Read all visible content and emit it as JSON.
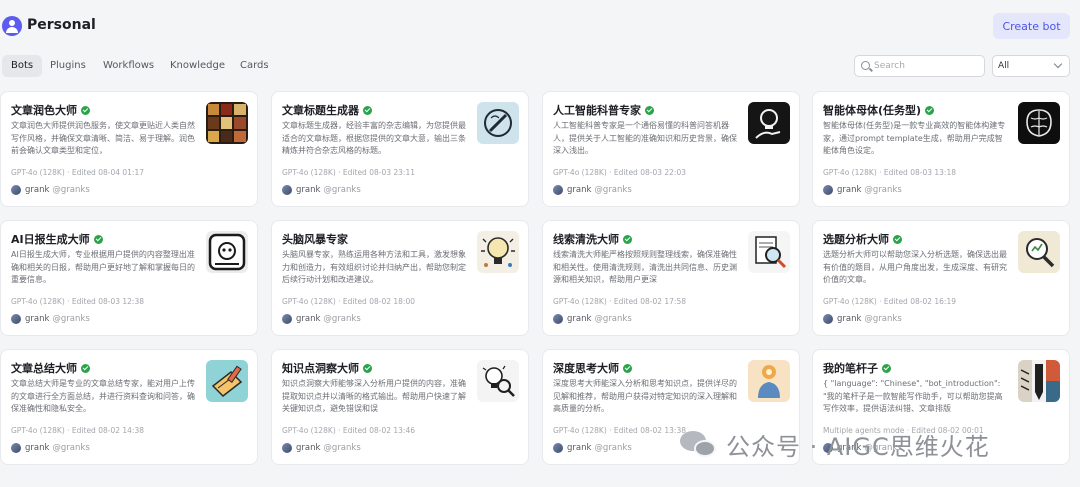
{
  "header": {
    "workspace_title": "Personal",
    "create_button": "Create bot"
  },
  "tabs": [
    {
      "label": "Bots",
      "active": true
    },
    {
      "label": "Plugins",
      "active": false
    },
    {
      "label": "Workflows",
      "active": false
    },
    {
      "label": "Knowledge",
      "active": false
    },
    {
      "label": "Cards",
      "active": false
    }
  ],
  "search": {
    "placeholder": "Search",
    "value": ""
  },
  "filter": {
    "selected": "All"
  },
  "colors": {
    "accent": "#4d53e8",
    "verified": "#2aa34a"
  },
  "bots": [
    {
      "title": "文章润色大师",
      "desc": "文章润色大师提供润色服务，使文章更贴近人类自然写作风格，并确保文章清晰、简洁、易于理解。润色前会确认文章类型和定位，",
      "meta": "GPT-4o (128K) · Edited 08-04 01:17",
      "author": "grank",
      "handle": "@granks",
      "thumb_icon": "mosaic-art-icon"
    },
    {
      "title": "文章标题生成器",
      "desc": "文章标题生成器，经验丰富的杂志编辑，为您提供最适合的文章标题，根据您提供的文章大意，输出三条精炼并符合杂志风格的标题。",
      "meta": "GPT-4o (128K) · Edited 08-03 23:11",
      "author": "grank",
      "handle": "@granks",
      "thumb_icon": "pen-circle-icon"
    },
    {
      "title": "人工智能科普专家",
      "desc": "人工智能科普专家是一个通俗易懂的科普问答机器人，提供关于人工智能的准确知识和历史背景，确保深入浅出。",
      "meta": "GPT-4o (128K) · Edited 08-03 22:03",
      "author": "grank",
      "handle": "@granks",
      "thumb_icon": "lightbulb-hand-icon"
    },
    {
      "title": "智能体母体(任务型)",
      "desc": "智能体母体(任务型)是一款专业高效的智能体构建专家，通过prompt template生成，帮助用户完成智能体角色设定。",
      "meta": "GPT-4o (128K) · Edited 08-03 13:18",
      "author": "grank",
      "handle": "@granks",
      "thumb_icon": "brain-icon"
    },
    {
      "title": "AI日报生成大师",
      "desc": "AI日报生成大师，专业根据用户提供的内容整理出准确和相关的日报，帮助用户更好地了解和掌握每日的重要信息。",
      "meta": "GPT-4o (128K) · Edited 08-03 12:38",
      "author": "grank",
      "handle": "@granks",
      "thumb_icon": "robot-newspaper-icon"
    },
    {
      "title": "头脑风暴专家",
      "desc": "头脑风暴专家，熟练运用各种方法和工具，激发想象力和创造力，有效组织讨论并归纳产出，帮助您制定后续行动计划和改进建议。",
      "meta": "GPT-4o (128K) · Edited 08-02 18:00",
      "author": "grank",
      "handle": "@granks",
      "thumb_icon": "idea-bulb-icon"
    },
    {
      "title": "线索清洗大师",
      "desc": "线索清洗大师能严格按照规则整理线索，确保准确性和相关性。使用清洗规则，清洗出共同信息、历史渊源和相关知识，帮助用户更深",
      "meta": "GPT-4o (128K) · Edited 08-02 17:58",
      "author": "grank",
      "handle": "@granks",
      "thumb_icon": "magnifier-doc-icon"
    },
    {
      "title": "选题分析大师",
      "desc": "选题分析大师可以帮助您深入分析选题，确保选出最有价值的题目，从用户角度出发，生成深度、有研究价值的文章。",
      "meta": "GPT-4o (128K) · Edited 08-02 16:19",
      "author": "grank",
      "handle": "@granks",
      "thumb_icon": "analysis-magnifier-icon"
    },
    {
      "title": "文章总结大师",
      "desc": "文章总结大师是专业的文章总结专家，能对用户上传的文章进行全方面总结，并进行资料查询和问答，确保准确性和隐私安全。",
      "meta": "GPT-4o (128K) · Edited 08-02 14:38",
      "author": "grank",
      "handle": "@granks",
      "thumb_icon": "book-pencil-icon"
    },
    {
      "title": "知识点洞察大师",
      "desc": "知识点洞察大师能够深入分析用户提供的内容，准确提取知识点并以清晰的格式输出。帮助用户快速了解关键知识点，避免错误和误",
      "meta": "GPT-4o (128K) · Edited 08-02 13:46",
      "author": "grank",
      "handle": "@granks",
      "thumb_icon": "bulb-magnifier-icon"
    },
    {
      "title": "深度思考大师",
      "desc": "深度思考大师能深入分析和思考知识点，提供详尽的见解和推荐，帮助用户获得对特定知识的深入理解和高质量的分析。",
      "meta": "GPT-4o (128K) · Edited 08-02 13:38",
      "author": "grank",
      "handle": "@granks",
      "thumb_icon": "thinker-icon"
    },
    {
      "title": "我的笔杆子",
      "desc": "{ \"language\": \"Chinese\", \"bot_introduction\": \"我的笔杆子是一款智能写作助手，可以帮助您提高写作效率，提供语法纠错、文章排版",
      "meta": "Multiple agents mode · Edited 08-02 00:01",
      "author": "grank",
      "handle": "@granks",
      "thumb_icon": "pencil-art-icon"
    }
  ],
  "watermark": {
    "text": "公众号 · AIGC思维火花"
  }
}
